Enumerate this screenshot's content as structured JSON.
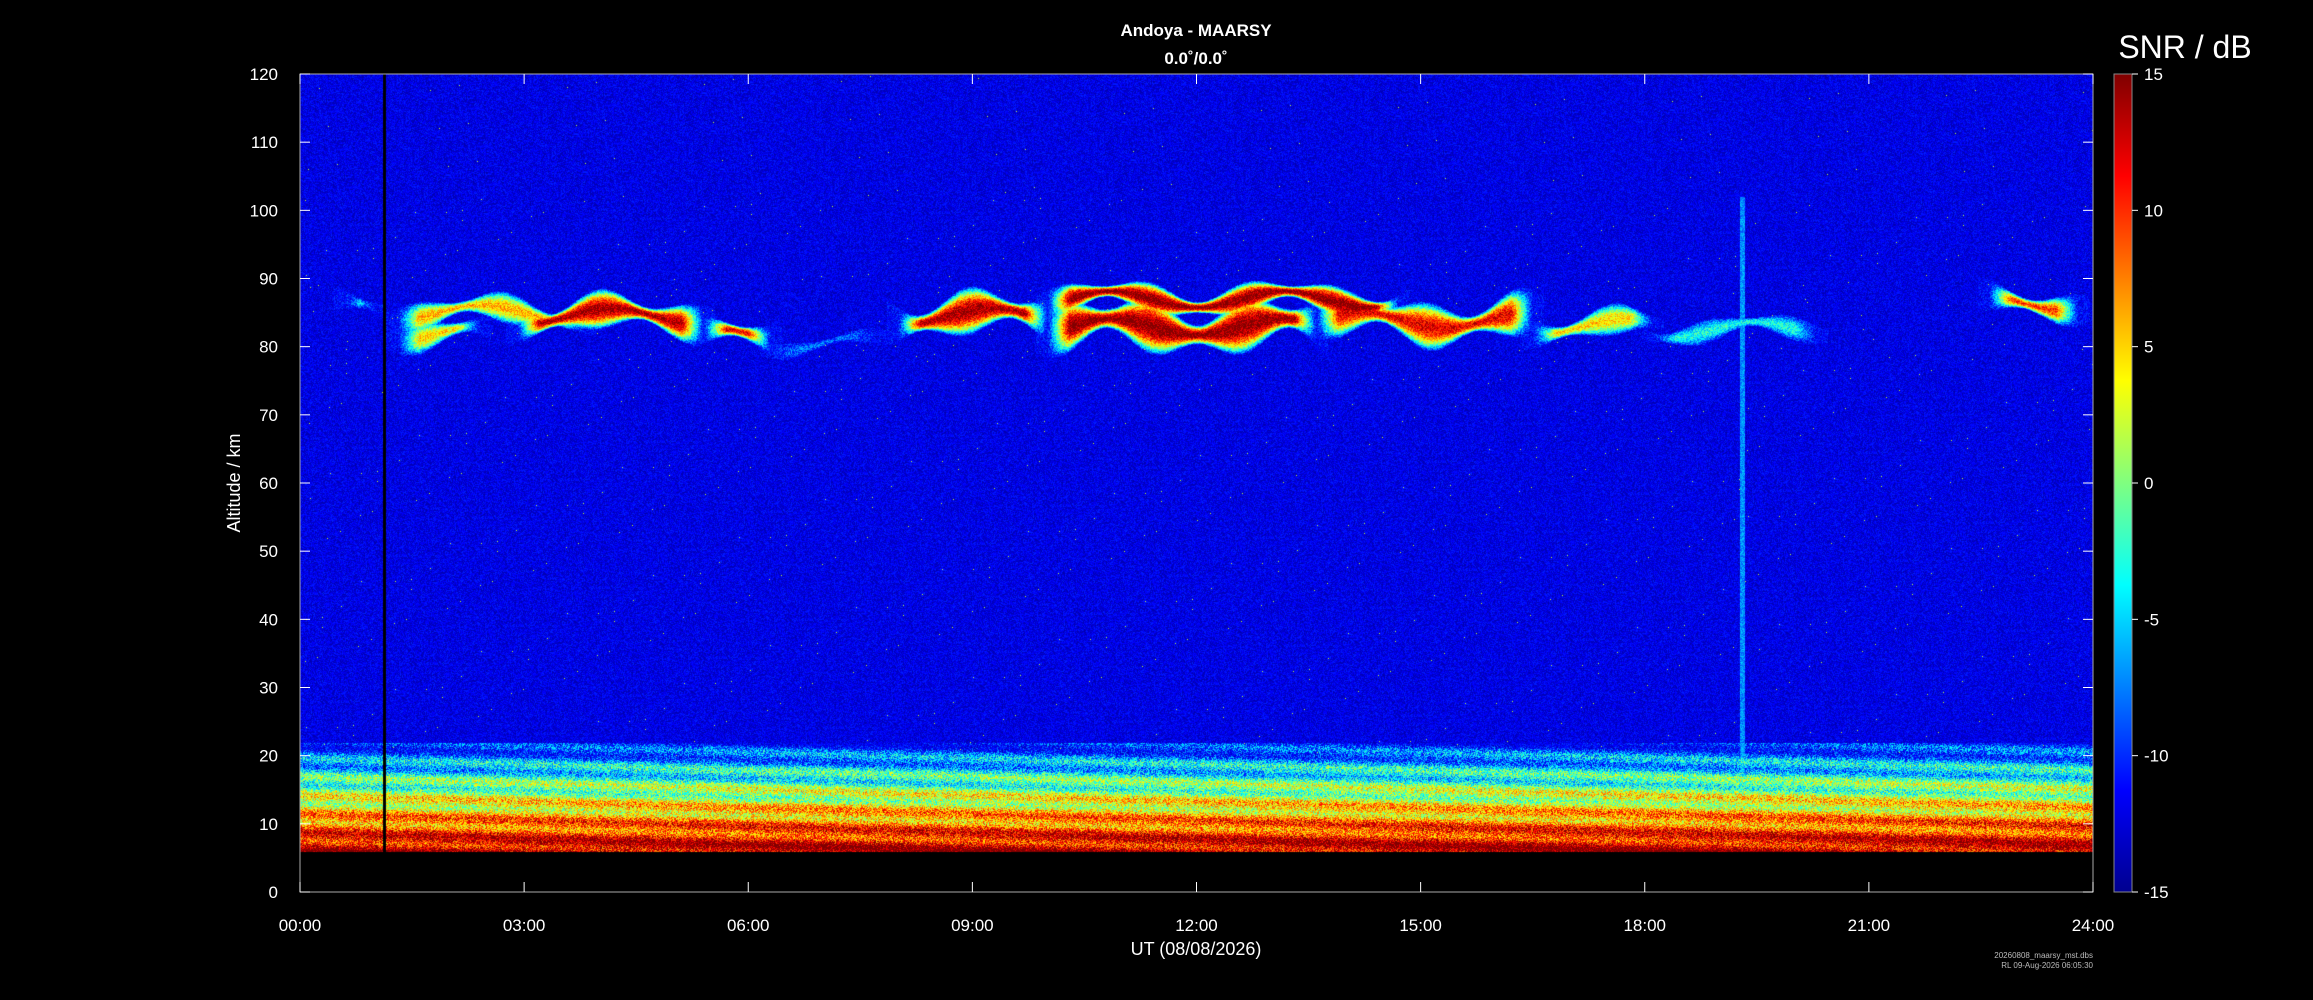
{
  "chart_data": {
    "type": "heatmap",
    "title": "Andoya - MAARSY",
    "subtitle": "0.0˚/0.0˚",
    "xlabel": "UT (08/08/2026)",
    "ylabel": "Altitude / km",
    "colorbar_label": "SNR / dB",
    "x_ticks": [
      "00:00",
      "03:00",
      "06:00",
      "09:00",
      "12:00",
      "15:00",
      "18:00",
      "21:00",
      "24:00"
    ],
    "y_ticks": [
      0,
      10,
      20,
      30,
      40,
      50,
      60,
      70,
      80,
      90,
      100,
      110,
      120
    ],
    "colorbar_ticks": [
      15,
      10,
      5,
      0,
      -5,
      -10,
      -15
    ],
    "xlim_hours": [
      0,
      24
    ],
    "ylim": [
      0,
      120
    ],
    "clim": [
      -15,
      15
    ],
    "colormap": "jet",
    "background_snr": -12,
    "features": {
      "data_gap_hours": [
        1.1,
        1.15
      ],
      "data_start_altitude_km": 6,
      "troposphere_echo_km": [
        6,
        22
      ],
      "pmse_layers": [
        {
          "start_h": 0.6,
          "end_h": 1.0,
          "alt_km": 86,
          "thickness_km": 1.5,
          "peak_snr": -2
        },
        {
          "start_h": 1.3,
          "end_h": 3.8,
          "alt_km": 85,
          "thickness_km": 2.0,
          "peak_snr": 6
        },
        {
          "start_h": 1.3,
          "end_h": 2.4,
          "alt_km": 82,
          "thickness_km": 2.0,
          "peak_snr": 5
        },
        {
          "start_h": 2.9,
          "end_h": 5.4,
          "alt_km": 84.5,
          "thickness_km": 2.5,
          "peak_snr": 14
        },
        {
          "start_h": 5.4,
          "end_h": 6.3,
          "alt_km": 81.5,
          "thickness_km": 2.0,
          "peak_snr": 12
        },
        {
          "start_h": 6.3,
          "end_h": 7.7,
          "alt_km": 80.5,
          "thickness_km": 1.0,
          "peak_snr": -8
        },
        {
          "start_h": 8.0,
          "end_h": 10.0,
          "alt_km": 84.5,
          "thickness_km": 3.0,
          "peak_snr": 14
        },
        {
          "start_h": 10.0,
          "end_h": 13.6,
          "alt_km": 83,
          "thickness_km": 3.5,
          "peak_snr": 15
        },
        {
          "start_h": 10.0,
          "end_h": 14.7,
          "alt_km": 87,
          "thickness_km": 2.0,
          "peak_snr": 15
        },
        {
          "start_h": 13.6,
          "end_h": 16.5,
          "alt_km": 84,
          "thickness_km": 3.0,
          "peak_snr": 12
        },
        {
          "start_h": 16.5,
          "end_h": 18.1,
          "alt_km": 83,
          "thickness_km": 2.0,
          "peak_snr": 5
        },
        {
          "start_h": 18.1,
          "end_h": 20.3,
          "alt_km": 82.5,
          "thickness_km": 1.5,
          "peak_snr": -3
        },
        {
          "start_h": 22.6,
          "end_h": 23.8,
          "alt_km": 86.5,
          "thickness_km": 2.0,
          "peak_snr": 10
        }
      ],
      "vertical_streak_hours": 19.3
    },
    "footer_file": "20260808_maarsy_mst.dbs",
    "footer_stamp": "RL 09-Aug-2026 06:05:30"
  }
}
